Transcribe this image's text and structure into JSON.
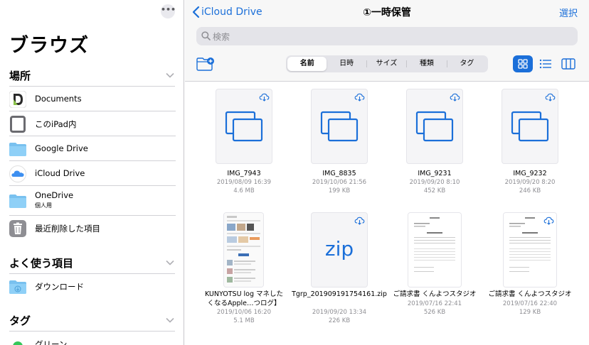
{
  "sidebar": {
    "more_label": "•••",
    "title": "ブラウズ",
    "locations_header": "場所",
    "locations": [
      {
        "label": "Documents",
        "icon": "documents-app-icon"
      },
      {
        "label": "このiPad内",
        "icon": "ipad-icon"
      },
      {
        "label": "Google Drive",
        "icon": "folder-icon"
      },
      {
        "label": "iCloud Drive",
        "icon": "icloud-icon"
      },
      {
        "label": "OneDrive",
        "sub": "個人用",
        "icon": "folder-icon"
      },
      {
        "label": "最近削除した項目",
        "icon": "trash-icon"
      }
    ],
    "favorites_header": "よく使う項目",
    "favorites": [
      {
        "label": "ダウンロード",
        "icon": "download-folder-icon"
      }
    ],
    "tags_header": "タグ",
    "tags": [
      {
        "label": "グリーン",
        "color": "#34c759"
      }
    ]
  },
  "main": {
    "back_label": "iCloud Drive",
    "title": "①一時保管",
    "select_label": "選択",
    "search_placeholder": "検索",
    "segments": [
      "名前",
      "日時",
      "サイズ",
      "種類",
      "タグ"
    ],
    "active_segment": "名前",
    "accent": "#1b6fd9",
    "files": [
      {
        "name": "IMG_7943",
        "date": "2019/08/09 16:39",
        "size": "4.6 MB",
        "type": "image"
      },
      {
        "name": "IMG_8835",
        "date": "2019/10/06 21:56",
        "size": "199 KB",
        "type": "image"
      },
      {
        "name": "IMG_9231",
        "date": "2019/09/20 8:10",
        "size": "452 KB",
        "type": "image"
      },
      {
        "name": "IMG_9232",
        "date": "2019/09/20 8:20",
        "size": "246 KB",
        "type": "image"
      },
      {
        "name": "KUNYOTSU log マネしたくなるApple…つログ】",
        "date": "2019/10/06 16:20",
        "size": "5.1 MB",
        "type": "webpage"
      },
      {
        "name": "Tgrp_201909191754161.zip",
        "date": "2019/09/20 13:34",
        "size": "226 KB",
        "type": "zip",
        "thumb_text": "zip"
      },
      {
        "name": "ご請求書 くんよつスタジオ",
        "date": "2019/07/16 22:41",
        "size": "526 KB",
        "type": "document"
      },
      {
        "name": "ご請求書 くんよつスタジオ",
        "date": "2019/07/16 22:40",
        "size": "129 KB",
        "type": "document"
      }
    ]
  }
}
